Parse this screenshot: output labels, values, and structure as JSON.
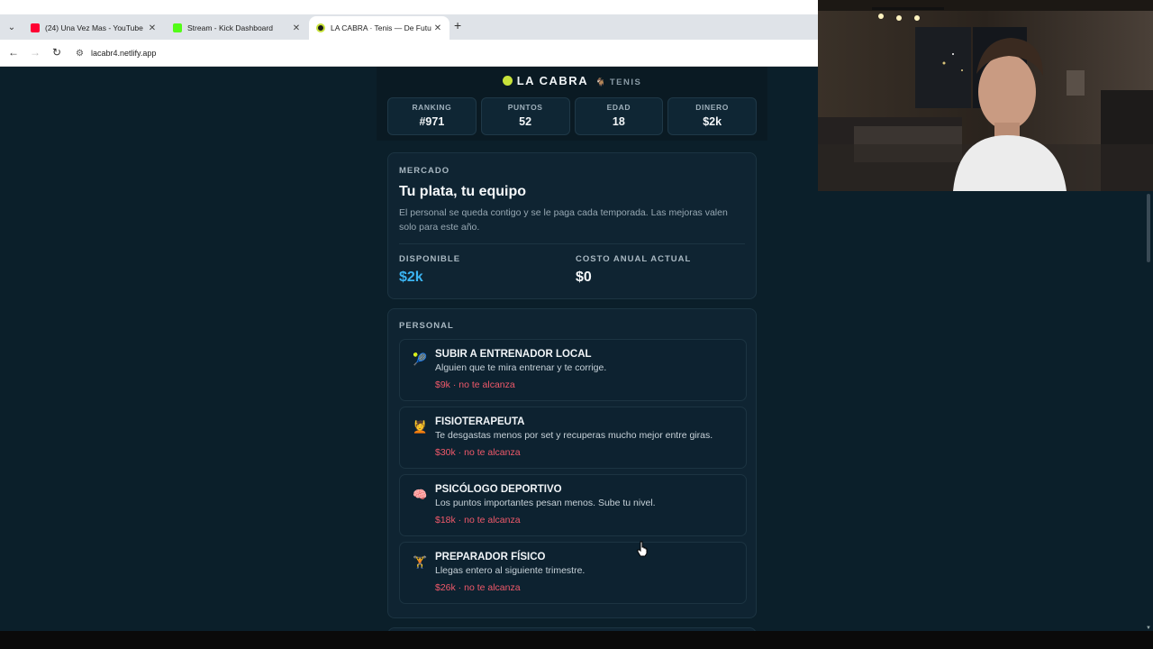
{
  "browser": {
    "tabs": [
      {
        "title": "(24) Una Vez Mas - YouTube",
        "favicon": "youtube-icon",
        "color": "#ff0033",
        "active": false
      },
      {
        "title": "Stream - Kick Dashboard",
        "favicon": "kick-icon",
        "color": "#53fc18",
        "active": false
      },
      {
        "title": "LA CABRA · Tenis — De Futures",
        "favicon": "netlify-icon",
        "color": "#1a1a1a",
        "active": true
      }
    ],
    "url": "lacabr4.netlify.app"
  },
  "app": {
    "brand": "LA CABRA",
    "subtitle": "TENIS",
    "stats": [
      {
        "label": "RANKING",
        "value": "#971"
      },
      {
        "label": "PUNTOS",
        "value": "52"
      },
      {
        "label": "EDAD",
        "value": "18"
      },
      {
        "label": "DINERO",
        "value": "$2k"
      }
    ]
  },
  "mercado": {
    "kicker": "MERCADO",
    "title": "Tu plata, tu equipo",
    "description": "El personal se queda contigo y se le paga cada temporada. Las mejoras valen solo para este año.",
    "disponible_label": "DISPONIBLE",
    "disponible_value": "$2k",
    "costo_label": "COSTO ANUAL ACTUAL",
    "costo_value": "$0"
  },
  "personal": {
    "kicker": "PERSONAL",
    "items": [
      {
        "icon": "tennis-coach-icon",
        "name": "SUBIR A ENTRENADOR LOCAL",
        "description": "Alguien que te mira entrenar y te corrige.",
        "price": "$9k · no te alcanza"
      },
      {
        "icon": "physio-icon",
        "name": "FISIOTERAPEUTA",
        "description": "Te desgastas menos por set y recuperas mucho mejor entre giras.",
        "price": "$30k · no te alcanza"
      },
      {
        "icon": "brain-icon",
        "name": "PSICÓLOGO DEPORTIVO",
        "description": "Los puntos importantes pesan menos. Sube tu nivel.",
        "price": "$18k · no te alcanza"
      },
      {
        "icon": "weightlifter-icon",
        "name": "PREPARADOR FÍSICO",
        "description": "Llegas entero al siguiente trimestre.",
        "price": "$26k · no te alcanza"
      }
    ]
  }
}
